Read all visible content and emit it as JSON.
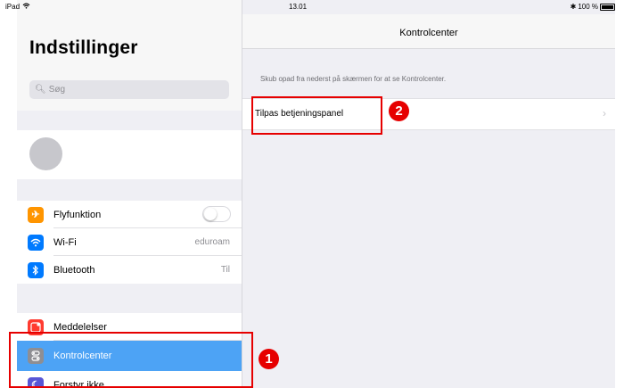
{
  "status_bar": {
    "device": "iPad",
    "time": "13.01",
    "battery": "100 %"
  },
  "sidebar": {
    "title": "Indstillinger",
    "search_placeholder": "Søg",
    "items": [
      {
        "label": "Flyfunktion",
        "icon": "airplane-icon",
        "color": "#ff9500",
        "value": "",
        "toggle": false
      },
      {
        "label": "Wi-Fi",
        "icon": "wifi-icon",
        "color": "#007aff",
        "value": "eduroam"
      },
      {
        "label": "Bluetooth",
        "icon": "bluetooth-icon",
        "color": "#007aff",
        "value": "Til"
      },
      {
        "label": "Meddelelser",
        "icon": "notifications-icon",
        "color": "#ff3b30"
      },
      {
        "label": "Kontrolcenter",
        "icon": "control-center-icon",
        "color": "#8e8e93",
        "selected": true
      },
      {
        "label": "Forstyr ikke",
        "icon": "moon-icon",
        "color": "#5856d6"
      }
    ]
  },
  "detail": {
    "title": "Kontrolcenter",
    "hint": "Skub opad fra nederst på skærmen for at se Kontrolcenter.",
    "cell_label": "Tilpas betjeningspanel",
    "chevron": "›"
  },
  "annotations": {
    "badge_1": "1",
    "badge_2": "2",
    "color": "#e60000"
  },
  "colors": {
    "selected_row": "#4da3f5",
    "background": "#efeff4"
  }
}
